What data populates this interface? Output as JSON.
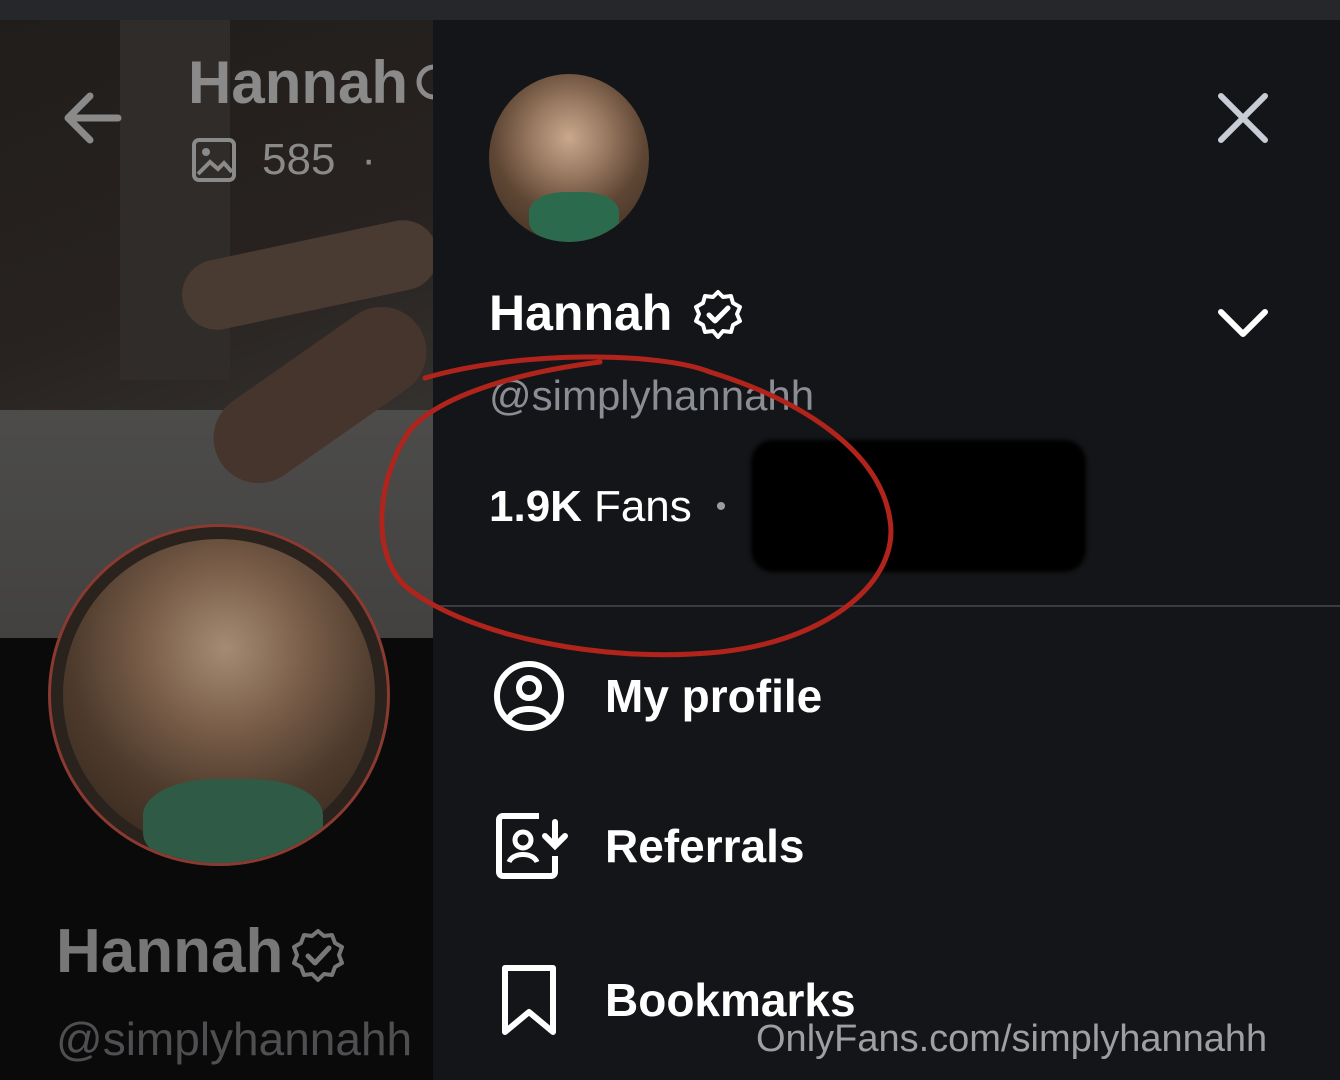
{
  "background_profile": {
    "title": "Hannah",
    "posts_count": "585",
    "separator": "·",
    "name": "Hannah",
    "handle": "@simplyhannahh"
  },
  "drawer": {
    "name": "Hannah",
    "handle": "@simplyhannahh",
    "fans_count": "1.9K",
    "fans_label": "Fans",
    "separator": "•",
    "menu": [
      {
        "label": "My profile",
        "icon": "user-circle-icon"
      },
      {
        "label": "Referrals",
        "icon": "referrals-icon"
      },
      {
        "label": "Bookmarks",
        "icon": "bookmark-icon"
      }
    ]
  },
  "watermark": "OnlyFans.com/simplyhannahh",
  "colors": {
    "drawer_bg": "#141518",
    "annotation_circle": "#b0241c",
    "handle_text": "#8b8d94"
  }
}
